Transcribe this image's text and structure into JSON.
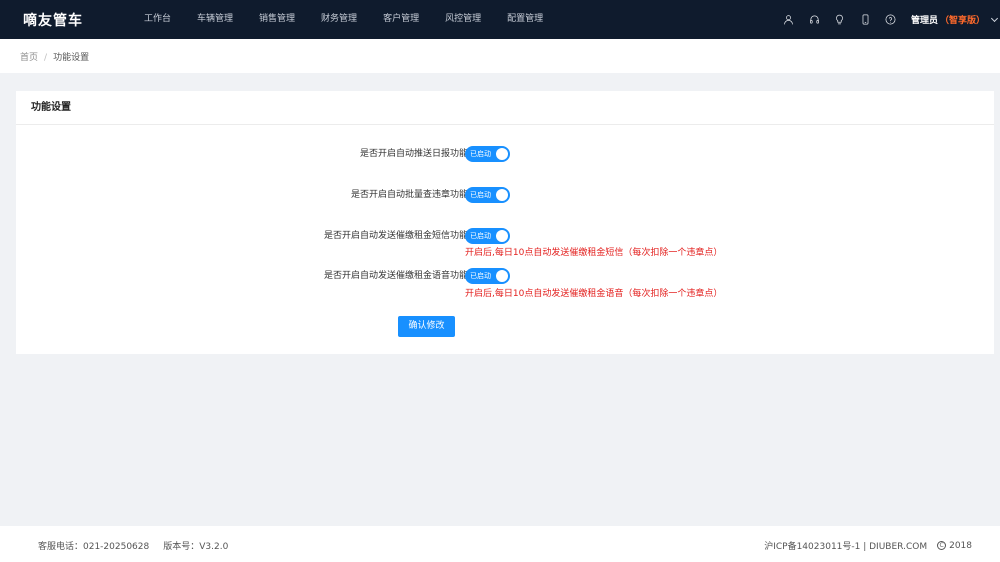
{
  "header": {
    "logo": "嘀友管车",
    "nav": [
      {
        "label": "工作台"
      },
      {
        "label": "车辆管理"
      },
      {
        "label": "销售管理"
      },
      {
        "label": "财务管理"
      },
      {
        "label": "客户管理"
      },
      {
        "label": "风控管理"
      },
      {
        "label": "配置管理"
      }
    ],
    "icons": [
      "user-icon",
      "headset-icon",
      "bulb-icon",
      "phone-icon",
      "help-icon"
    ],
    "user": {
      "role": "管理员",
      "edition": "（智享版）"
    }
  },
  "breadcrumb": {
    "home": "首页",
    "separator": "/",
    "current": "功能设置"
  },
  "card": {
    "title": "功能设置"
  },
  "form": {
    "rows": [
      {
        "label": "是否开启自动推送日报功能：",
        "switch_text": "已启动",
        "enabled": true,
        "hint": ""
      },
      {
        "label": "是否开启自动批量查违章功能：",
        "switch_text": "已启动",
        "enabled": true,
        "hint": ""
      },
      {
        "label": "是否开启自动发送催缴租金短信功能：",
        "switch_text": "已启动",
        "enabled": true,
        "hint": "开启后,每日10点自动发送催缴租金短信（每次扣除一个违章点）"
      },
      {
        "label": "是否开启自动发送催缴租金语音功能：",
        "switch_text": "已启动",
        "enabled": true,
        "hint": "开启后,每日10点自动发送催缴租金语音（每次扣除一个违章点）"
      }
    ],
    "submit_label": "确认修改"
  },
  "footer": {
    "service_phone": "客服电话：021-20250628",
    "version": "版本号：V3.2.0",
    "icp": "沪ICP备14023011号-1 | DIUBER.COM",
    "copyright_year": "2018"
  },
  "colors": {
    "header_bg": "#0f1b2d",
    "accent": "#1890ff",
    "warning": "#e3211f",
    "edition": "#ff6a2b"
  }
}
